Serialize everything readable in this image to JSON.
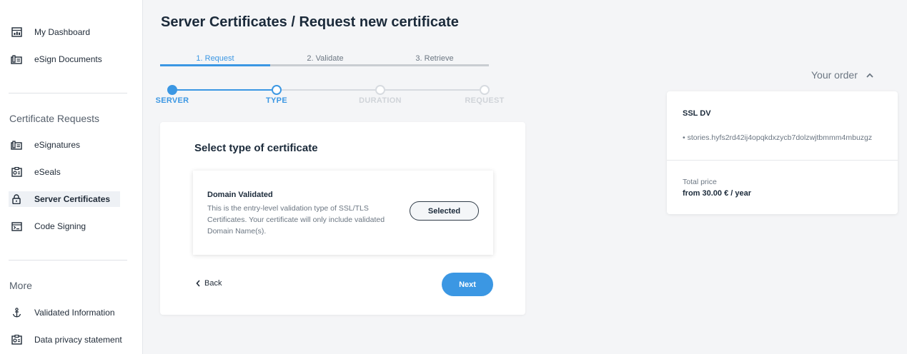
{
  "sidebar": {
    "top_items": [
      {
        "label": "My Dashboard",
        "icon": "dashboard-icon"
      },
      {
        "label": "eSign Documents",
        "icon": "esign-documents-icon"
      }
    ],
    "section_certificates": "Certificate Requests",
    "cert_items": [
      {
        "label": "eSignatures",
        "icon": "esignatures-icon"
      },
      {
        "label": "eSeals",
        "icon": "eseals-icon"
      },
      {
        "label": "Server Certificates",
        "icon": "lock-icon",
        "active": true
      },
      {
        "label": "Code Signing",
        "icon": "code-signing-icon"
      }
    ],
    "section_more": "More",
    "more_items": [
      {
        "label": "Validated Information",
        "icon": "anchor-icon"
      },
      {
        "label": "Data privacy statement",
        "icon": "privacy-icon"
      }
    ]
  },
  "page_title": "Server Certificates / Request new certificate",
  "tabs": [
    {
      "label": "1. Request",
      "active": true
    },
    {
      "label": "2. Validate",
      "active": false
    },
    {
      "label": "3. Retrieve",
      "active": false
    }
  ],
  "steps": [
    {
      "label": "SERVER",
      "state": "done"
    },
    {
      "label": "TYPE",
      "state": "current"
    },
    {
      "label": "DURATION",
      "state": "pending"
    },
    {
      "label": "REQUEST",
      "state": "pending"
    }
  ],
  "card": {
    "title": "Select type of certificate",
    "option": {
      "title": "Domain Validated",
      "description": "This is the entry-level validation type of SSL/TLS Certificates. Your certificate will only include validated Domain Name(s).",
      "button": "Selected"
    },
    "back_label": "Back",
    "next_label": "Next"
  },
  "order": {
    "header": "Your order",
    "product": "SSL DV",
    "domain": "• stories.hyfs2rd42ij4opqkdxzycb7dolzwjtbmmm4mbuzgz",
    "total_label": "Total price",
    "total_value": "from 30.00 € / year"
  },
  "colors": {
    "accent": "#3b97e3",
    "text": "#1b2a3a",
    "muted": "#6b7682"
  }
}
